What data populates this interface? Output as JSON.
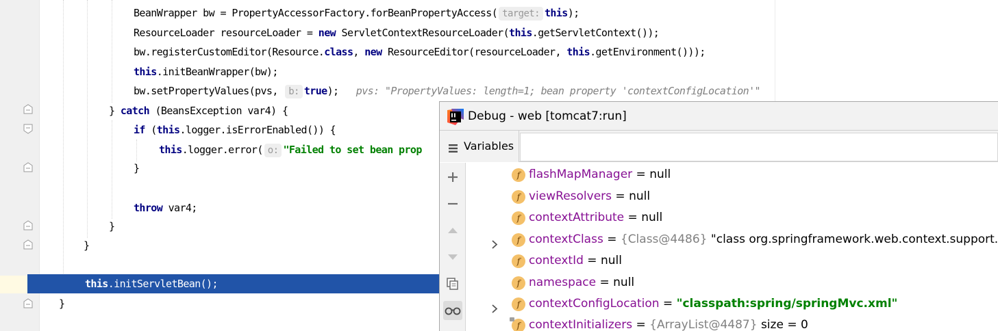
{
  "editor": {
    "code": {
      "l1": {
        "a": "BeanWrapper bw = PropertyAccessorFactory.forBeanPropertyAccess(",
        "hint": "target:",
        "kw": "this",
        "b": ");"
      },
      "l2": {
        "a": "ResourceLoader resourceLoader = ",
        "kw1": "new",
        "b": " ServletContextResourceLoader(",
        "kw2": "this",
        "c": ".getServletContext());"
      },
      "l3": {
        "a": "bw.registerCustomEditor(Resource.",
        "kw1": "class",
        "b": ", ",
        "kw2": "new",
        "c": " ResourceEditor(resourceLoader, ",
        "kw3": "this",
        "d": ".getEnvironment()));"
      },
      "l4": {
        "kw": "this",
        "a": ".initBeanWrapper(bw);"
      },
      "l5": {
        "a": "bw.setPropertyValues(pvs, ",
        "hint": "b:",
        "kw": "true",
        "b": ");",
        "comment": "pvs: \"PropertyValues: length=1; bean property 'contextConfigLocation'\""
      },
      "l6": {
        "a": "} ",
        "kw": "catch",
        "b": " (BeansException var4) {"
      },
      "l7": {
        "kw1": "if",
        "a": " (",
        "kw2": "this",
        "b": ".logger.isErrorEnabled()) {"
      },
      "l8": {
        "kw": "this",
        "a": ".logger.error(",
        "hint": "o:",
        "str": "\"Failed to set bean prop"
      },
      "l9": {
        "a": "}"
      },
      "l10": {
        "kw": "throw",
        "a": " var4;"
      },
      "l11": {
        "a": "}"
      },
      "l12": {
        "a": "}"
      },
      "l13": {
        "kw": "this",
        "a": ".initServletBean();"
      },
      "l14": {
        "a": "}"
      }
    }
  },
  "debug": {
    "title": "Debug - web [tomcat7:run]",
    "tab_label": "Variables",
    "variables": [
      {
        "name": "flashMapManager",
        "eq": " = ",
        "value": "null",
        "kind": "null",
        "expandable": false
      },
      {
        "name": "viewResolvers",
        "eq": " = ",
        "value": "null",
        "kind": "null",
        "expandable": false
      },
      {
        "name": "contextAttribute",
        "eq": " = ",
        "value": "null",
        "kind": "null",
        "expandable": false
      },
      {
        "name": "contextClass",
        "eq": " = ",
        "ref": "{Class@4486}",
        "value": " \"class org.springframework.web.context.support.Xml",
        "kind": "plain",
        "expandable": true
      },
      {
        "name": "contextId",
        "eq": " = ",
        "value": "null",
        "kind": "null",
        "expandable": false
      },
      {
        "name": "namespace",
        "eq": " = ",
        "value": "null",
        "kind": "null",
        "expandable": false
      },
      {
        "name": "contextConfigLocation",
        "eq": " = ",
        "value": "\"classpath:spring/springMvc.xml\"",
        "kind": "str",
        "expandable": true
      },
      {
        "name": "contextInitializers",
        "eq": " = ",
        "ref": "{ArrayList@4487}",
        "value": "  size = 0",
        "kind": "plain",
        "expandable": false
      }
    ],
    "field_icon_letter": "f"
  },
  "colors": {
    "keyword": "#000080",
    "string": "#008000",
    "execution_line": "#2154a8",
    "field_name": "#871094",
    "field_icon": "#f4c069"
  }
}
